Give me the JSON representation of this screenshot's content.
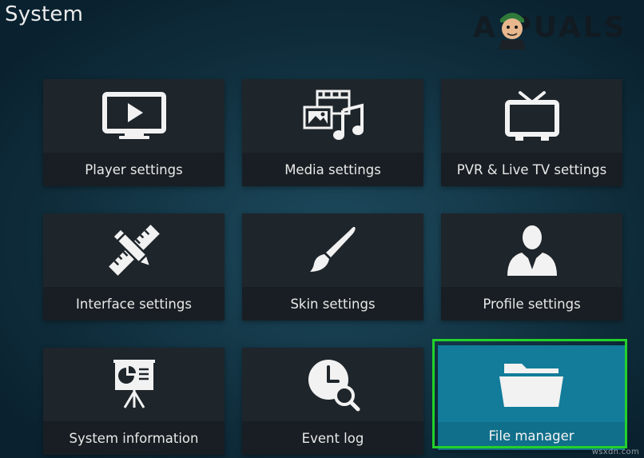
{
  "page": {
    "title": "System"
  },
  "watermark": {
    "text": "A  PUALS"
  },
  "tiles": [
    {
      "label": "Player settings",
      "icon": "tv-play-icon"
    },
    {
      "label": "Media settings",
      "icon": "media-icon"
    },
    {
      "label": "PVR & Live TV settings",
      "icon": "tv-antenna-icon"
    },
    {
      "label": "Interface settings",
      "icon": "pencil-ruler-icon"
    },
    {
      "label": "Skin settings",
      "icon": "paintbrush-icon"
    },
    {
      "label": "Profile settings",
      "icon": "person-icon"
    },
    {
      "label": "System information",
      "icon": "presentation-chart-icon"
    },
    {
      "label": "Event log",
      "icon": "clock-search-icon"
    },
    {
      "label": "File manager",
      "icon": "folder-icon",
      "selected": true
    }
  ],
  "footer": {
    "source_stamp": "wsxdn.com"
  },
  "colors": {
    "background": "#163c4d",
    "tile": "#1e252b",
    "tile_selected": "#127c9a",
    "focus_ring": "#23d12a",
    "text": "#e9e9e9"
  }
}
